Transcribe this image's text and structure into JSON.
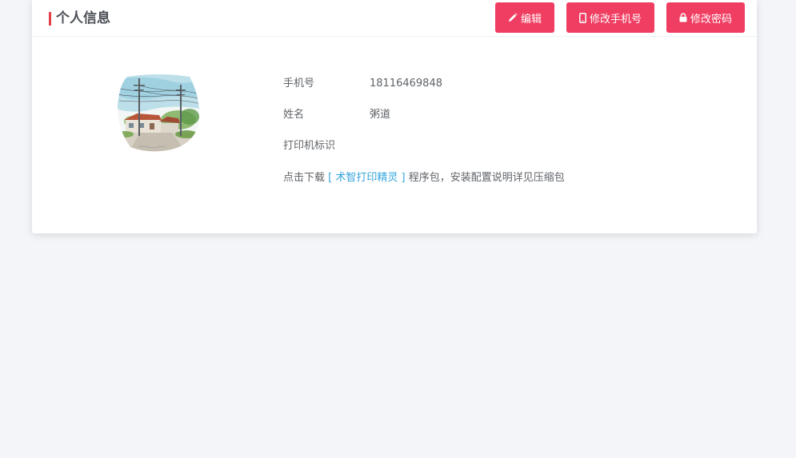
{
  "header": {
    "title": "个人信息",
    "buttons": {
      "edit": "编辑",
      "change_phone": "修改手机号",
      "change_password": "修改密码"
    }
  },
  "profile": {
    "phone_label": "手机号",
    "phone_value": "18116469848",
    "name_label": "姓名",
    "name_value": "粥道",
    "printer_label": "打印机标识",
    "printer_value": ""
  },
  "download": {
    "prefix": "点击下载",
    "link_text": "[ 术智打印精灵 ]",
    "suffix": "程序包，安装配置说明详见压缩包"
  },
  "colors": {
    "accent": "#f03e62",
    "title_bar": "#e23f47",
    "link": "#35a4dd",
    "background": "#f3f5f9"
  },
  "icons": {
    "edit": "pencil-icon",
    "phone": "mobile-phone-icon",
    "password": "lock-icon"
  }
}
